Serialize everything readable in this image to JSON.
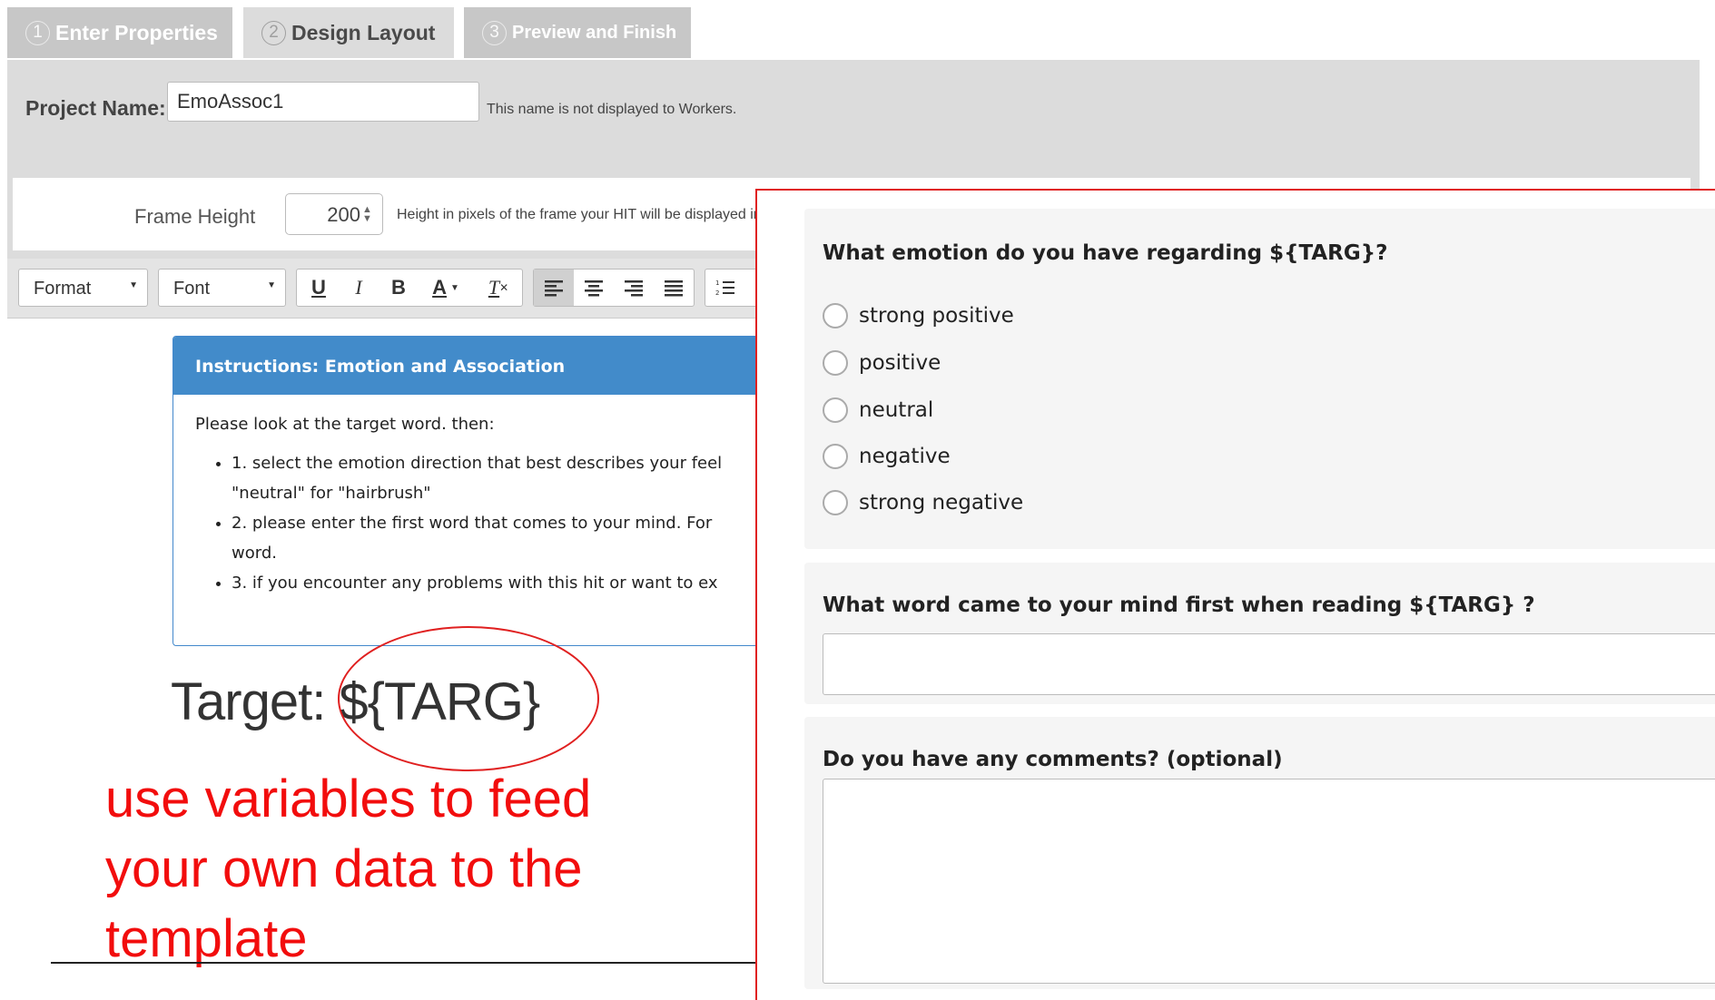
{
  "tabs": [
    {
      "num": "1",
      "label": "Enter Properties"
    },
    {
      "num": "2",
      "label": "Design Layout"
    },
    {
      "num": "3",
      "label": "Preview and Finish"
    }
  ],
  "project": {
    "label": "Project Name:",
    "value": "EmoAssoc1",
    "note": "This name is not displayed to Workers."
  },
  "frame": {
    "label": "Frame Height",
    "value": "200",
    "note": "Height in pixels of the frame your HIT will be displayed in"
  },
  "toolbar": {
    "format_label": "Format",
    "font_label": "Font",
    "underline": "U",
    "italic": "I",
    "bold": "B",
    "font_color": "A",
    "clear_format": "T"
  },
  "instructions": {
    "title": "Instructions: Emotion and Association",
    "intro": "Please look at the target word. then:",
    "items": [
      "1. select the emotion direction that best describes your feel",
      "\"neutral\" for \"hairbrush\"",
      "2. please enter the first word that comes to your mind. For",
      "word.",
      "3. if you encounter any problems with this hit or want to ex"
    ]
  },
  "target_text": "Target: ${TARG}",
  "annotation": "use variables to feed your own data to the template",
  "preview": {
    "q1": "What emotion do you have regarding ${TARG}?",
    "options": [
      "strong positive",
      "positive",
      "neutral",
      "negative",
      "strong negative"
    ],
    "q2": "What word came to your mind first when reading ${TARG} ?",
    "q3": "Do you have any comments? (optional)"
  },
  "colors": {
    "instructions_header": "#428bca",
    "annotation_red": "#f20d0d",
    "panel_grey": "#dcdcdc"
  }
}
